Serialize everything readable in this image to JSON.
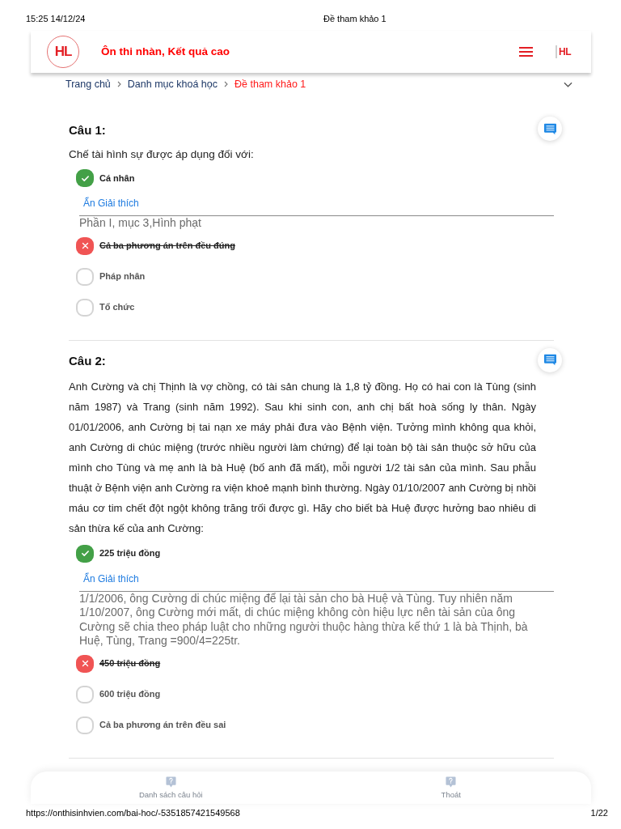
{
  "print_header": {
    "datetime": "15:25 14/12/24",
    "title": "Đề tham khảo 1"
  },
  "site_header": {
    "logo_text": "HL",
    "tagline": "Ôn thi nhàn, Kết quả cao",
    "account_logo_text": "HL"
  },
  "breadcrumb": [
    {
      "label": "Trang chủ",
      "current": false
    },
    {
      "label": "Danh mục khoá học",
      "current": false
    },
    {
      "label": "Đề tham khảo 1",
      "current": true
    }
  ],
  "questions": [
    {
      "title": "Câu 1:",
      "text": "Chế tài hình sự được áp dụng đối với:",
      "options": [
        {
          "label": "Cá nhân",
          "kind": "correct",
          "explanation": {
            "toggle": "Ẩn Giải thích",
            "text": "Phần I, mục 3,Hình phạt"
          }
        },
        {
          "label": "Cả ba phương án trên đều đúng",
          "kind": "wrong"
        },
        {
          "label": "Pháp nhân",
          "kind": "unanswered"
        },
        {
          "label": "Tổ chức",
          "kind": "unanswered"
        }
      ]
    },
    {
      "title": "Câu 2:",
      "text": "Anh Cường và chị Thịnh là vợ chồng, có tài sản chung là 1,8 tỷ đồng. Họ có hai con là Tùng (sinh năm 1987) và Trang (sinh năm 1992). Sau khi sinh con, anh chị bất hoà sống ly thân. Ngày 01/01/2006, anh Cường bị tai nạn xe máy phải đưa vào Bệnh viện. Tưởng mình không qua khỏi, anh Cường di chúc miệng (trước nhiều người làm chứng) để lại toàn bộ tài sản thuộc sở hữu của mình cho Tùng và mẹ anh là bà Huệ (bố anh đã mất), mỗi người 1/2 tài sản của mình. Sau phẫu thuật ở Bệnh viện anh Cường ra viện khoẻ mạnh bình thường. Ngày 01/10/2007 anh Cường bị nhồi máu cơ tim chết đột ngột không trăng trối được gì. Hãy cho biết bà Huệ được hưởng bao nhiêu di sản thừa kế của anh Cường:",
      "options": [
        {
          "label": "225 triệu đồng",
          "kind": "correct",
          "explanation": {
            "toggle": "Ẩn Giải thích",
            "text": "1/1/2006, ông Cường di chúc miệng để lại tài sản cho bà Huệ và Tùng. Tuy nhiên năm 1/10/2007, ông Cường mới mất, di chúc miệng không còn hiệu lực nên tài sản của ông Cường sẽ chia theo pháp luật cho những người thuộc hàng thừa kế thứ 1 là bà Thịnh, bà Huệ, Tùng, Trang =900/4=225tr."
          }
        },
        {
          "label": "450 triệu đồng",
          "kind": "wrong"
        },
        {
          "label": "600 triệu đồng",
          "kind": "unanswered"
        },
        {
          "label": "Cả ba phương án trên đều sai",
          "kind": "unanswered"
        }
      ]
    }
  ],
  "bottom_nav": [
    {
      "label": "Danh sách câu hỏi"
    },
    {
      "label": "Thoát"
    }
  ],
  "print_footer": {
    "url": "https://onthisinhvien.com/bai-hoc/-5351857421549568",
    "page": "1/22"
  }
}
